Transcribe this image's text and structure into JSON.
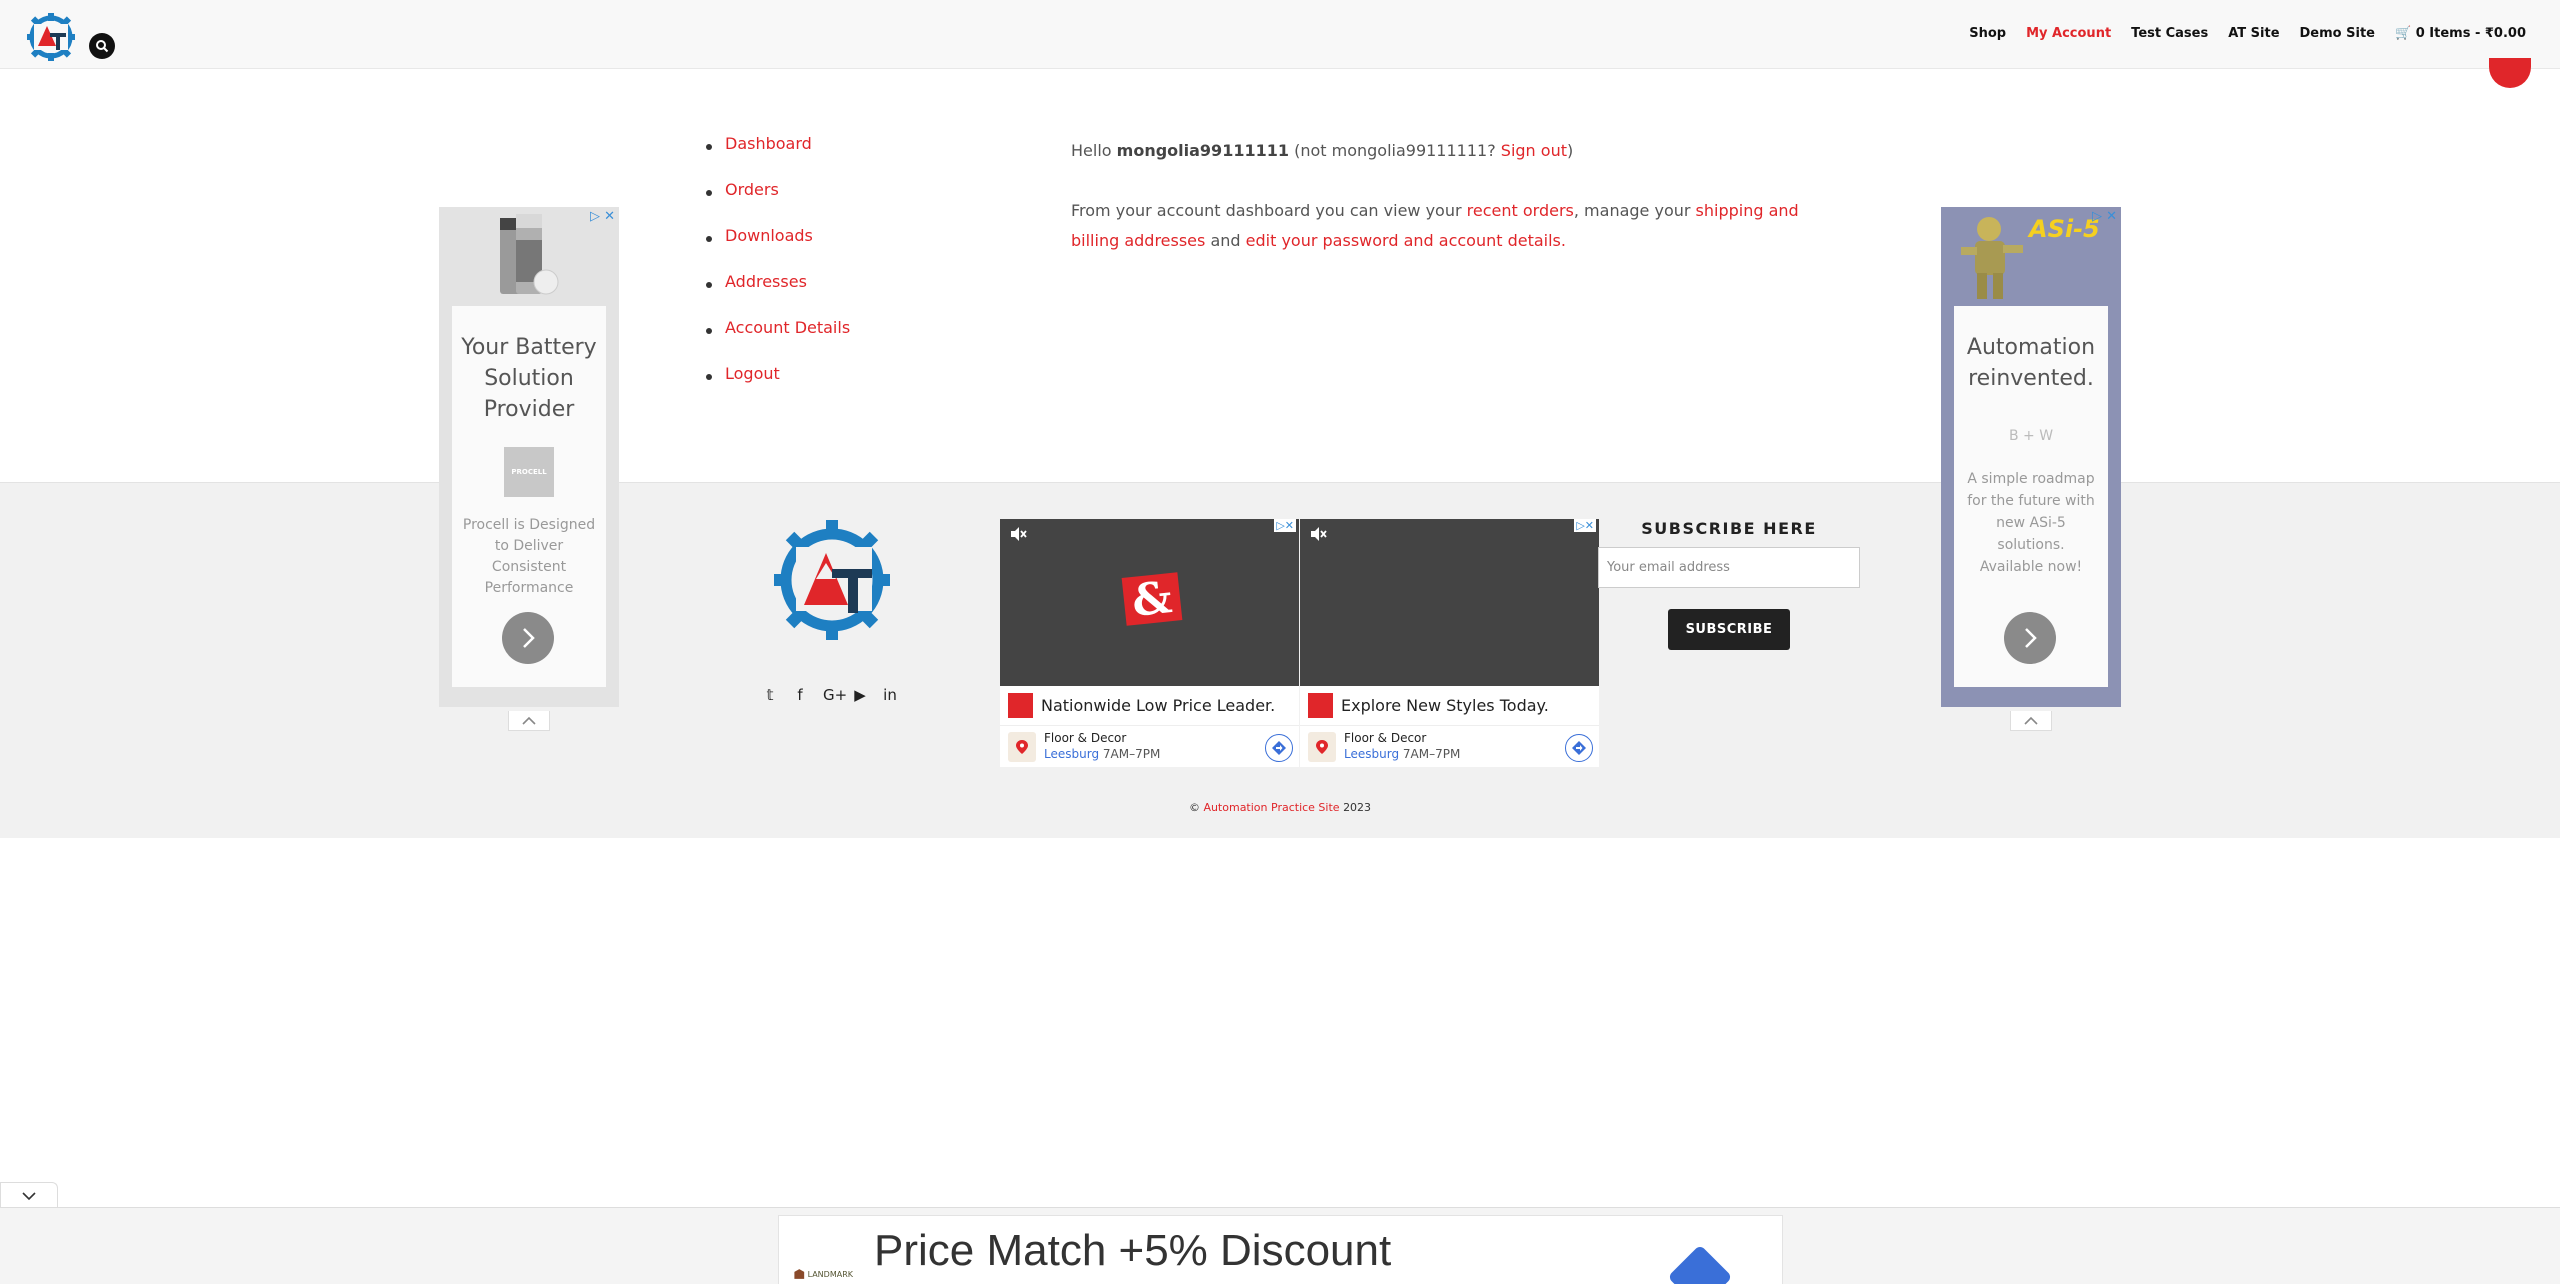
{
  "header": {
    "nav": [
      "Shop",
      "My Account",
      "Test Cases",
      "AT Site",
      "Demo Site"
    ],
    "active_nav": "My Account",
    "cart": "0 Items - ₹0.00"
  },
  "account_nav": [
    "Dashboard",
    "Orders",
    "Downloads",
    "Addresses",
    "Account Details",
    "Logout"
  ],
  "welcome": {
    "hello": "Hello",
    "username": "mongolia99111111",
    "not_text": "(not mongolia99111111?",
    "sign_out": "Sign out",
    "close_paren": ")",
    "line2_a": "From your account dashboard you can view your",
    "recent_orders": "recent orders",
    "line2_b": ", manage your",
    "shipping": "shipping and billing addresses",
    "line2_c": "and",
    "edit": "edit your password and account details",
    "period": "."
  },
  "side_ad_left": {
    "headline": "Your Battery Solution Provider",
    "brand": "PROCELL",
    "body": "Procell is Designed to Deliver Consistent Performance"
  },
  "side_ad_right": {
    "banner": "ASi-5",
    "headline": "Automation reinvented.",
    "brand": "B + W",
    "body": "A simple roadmap for the future with new ASi-5 solutions. Available now!"
  },
  "footer": {
    "subscribe_title": "SUBSCRIBE HERE",
    "email_placeholder": "Your email address",
    "subscribe_button": "SUBSCRIBE",
    "copyright_prefix": "©",
    "copyright_link": "Automation Practice Site",
    "copyright_year": "2023",
    "social": [
      "twitter-icon",
      "facebook-icon",
      "google-plus-icon",
      "youtube-icon",
      "linkedin-icon"
    ]
  },
  "video_ads": [
    {
      "title": "Nationwide Low Price Leader.",
      "advertiser": "Floor & Decor",
      "location": "Leesburg",
      "hours": "7AM–7PM"
    },
    {
      "title": "Explore New Styles Today.",
      "advertiser": "Floor & Decor",
      "location": "Leesburg",
      "hours": "7AM–7PM"
    }
  ],
  "bottom_ad": {
    "title": "Price Match +5% Discount",
    "logo_text": "LANDMARK"
  },
  "colors": {
    "accent": "#e0262a",
    "logo_blue": "#1e7fc2",
    "dark": "#222222"
  }
}
